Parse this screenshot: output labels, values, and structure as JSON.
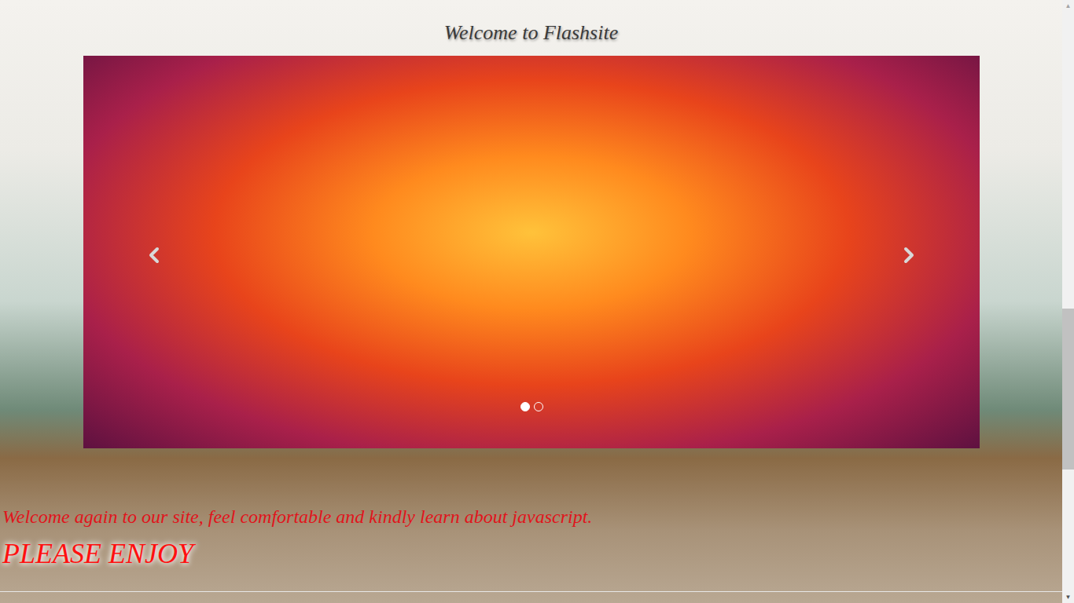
{
  "page": {
    "title": "Welcome to Flashsite"
  },
  "carousel": {
    "indicators": [
      {
        "selected": true
      },
      {
        "selected": false
      }
    ]
  },
  "content": {
    "welcome": "Welcome again to our site, feel comfortable and kindly learn about javascript.",
    "tagline": "PLEASE ENJOY"
  },
  "scrollbar": {
    "level": 1
  }
}
